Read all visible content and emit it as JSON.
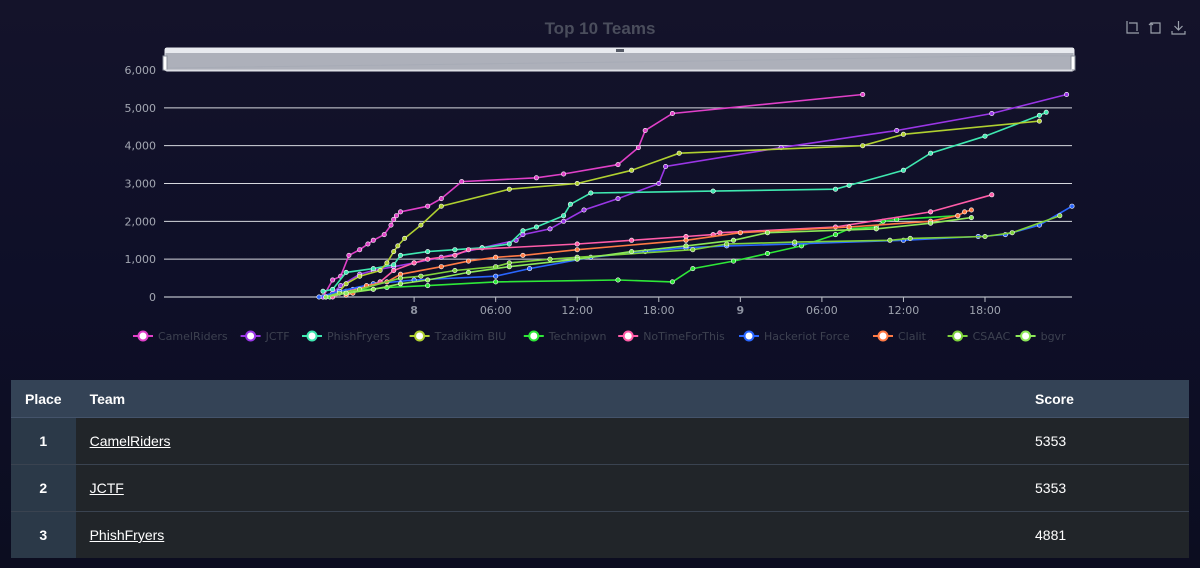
{
  "toolbox": {
    "icons": [
      "zoom-icon",
      "zoom-reset-icon",
      "download-icon"
    ]
  },
  "chart_data": {
    "type": "line",
    "title": "Top 10 Teams",
    "xlabel": "",
    "ylabel": "",
    "x_unit": "hours since day 7 00:00",
    "x_range": [
      5.6,
      72.4
    ],
    "ylim": [
      0,
      6000
    ],
    "y_ticks": [
      0,
      1000,
      2000,
      3000,
      4000,
      5000,
      6000
    ],
    "y_tick_labels": [
      "0",
      "1,000",
      "2,000",
      "3,000",
      "4,000",
      "5,000",
      "6,000"
    ],
    "x_ticks": [
      {
        "x": 24,
        "label": "8",
        "major": true
      },
      {
        "x": 30,
        "label": "06:00",
        "major": false
      },
      {
        "x": 36,
        "label": "12:00",
        "major": false
      },
      {
        "x": 42,
        "label": "18:00",
        "major": false
      },
      {
        "x": 48,
        "label": "9",
        "major": true
      },
      {
        "x": 54,
        "label": "06:00",
        "major": false
      },
      {
        "x": 60,
        "label": "12:00",
        "major": false
      },
      {
        "x": 66,
        "label": "18:00",
        "major": false
      }
    ],
    "grid": true,
    "legend_position": "bottom",
    "series": [
      {
        "name": "CamelRiders",
        "color": "#e040c8",
        "points": [
          [
            17.3,
            0
          ],
          [
            18.0,
            450
          ],
          [
            18.6,
            550
          ],
          [
            19.2,
            1100
          ],
          [
            20.0,
            1250
          ],
          [
            20.6,
            1400
          ],
          [
            21.0,
            1500
          ],
          [
            21.8,
            1650
          ],
          [
            22.3,
            1900
          ],
          [
            22.5,
            2050
          ],
          [
            22.7,
            2150
          ],
          [
            23.0,
            2250
          ],
          [
            25.0,
            2400
          ],
          [
            26.0,
            2600
          ],
          [
            27.5,
            3050
          ],
          [
            33.0,
            3150
          ],
          [
            35.0,
            3250
          ],
          [
            39.0,
            3500
          ],
          [
            40.5,
            3950
          ],
          [
            41.0,
            4400
          ],
          [
            43.0,
            4850
          ],
          [
            57.0,
            5353
          ]
        ]
      },
      {
        "name": "JCTF",
        "color": "#9a36e6",
        "points": [
          [
            17.3,
            0
          ],
          [
            18.0,
            100
          ],
          [
            18.6,
            300
          ],
          [
            20.0,
            600
          ],
          [
            21.0,
            700
          ],
          [
            22.5,
            800
          ],
          [
            24.0,
            900
          ],
          [
            26.0,
            1050
          ],
          [
            29.0,
            1300
          ],
          [
            31.5,
            1500
          ],
          [
            32.0,
            1650
          ],
          [
            34.0,
            1800
          ],
          [
            35.0,
            2000
          ],
          [
            36.5,
            2300
          ],
          [
            39.0,
            2600
          ],
          [
            42.0,
            3000
          ],
          [
            42.5,
            3450
          ],
          [
            51.0,
            3950
          ],
          [
            59.5,
            4400
          ],
          [
            66.5,
            4850
          ],
          [
            72.0,
            5353
          ]
        ]
      },
      {
        "name": "PhishFryers",
        "color": "#3fe8b0",
        "points": [
          [
            17.3,
            150
          ],
          [
            18.0,
            200
          ],
          [
            19.0,
            650
          ],
          [
            21.0,
            750
          ],
          [
            22.5,
            850
          ],
          [
            23.0,
            1100
          ],
          [
            25.0,
            1200
          ],
          [
            27.0,
            1250
          ],
          [
            29.0,
            1300
          ],
          [
            31.0,
            1400
          ],
          [
            32.0,
            1750
          ],
          [
            33.0,
            1850
          ],
          [
            35.0,
            2150
          ],
          [
            35.5,
            2450
          ],
          [
            37.0,
            2750
          ],
          [
            46.0,
            2800
          ],
          [
            55.0,
            2850
          ],
          [
            56.0,
            2950
          ],
          [
            60.0,
            3350
          ],
          [
            62.0,
            3800
          ],
          [
            66.0,
            4250
          ],
          [
            70.0,
            4800
          ],
          [
            70.5,
            4881
          ]
        ]
      },
      {
        "name": "Tzadikim BIU",
        "color": "#b0d030",
        "points": [
          [
            17.5,
            0
          ],
          [
            18.5,
            150
          ],
          [
            19.0,
            350
          ],
          [
            20.0,
            550
          ],
          [
            21.5,
            700
          ],
          [
            22.0,
            900
          ],
          [
            22.5,
            1200
          ],
          [
            22.8,
            1350
          ],
          [
            23.3,
            1550
          ],
          [
            24.5,
            1900
          ],
          [
            26.0,
            2400
          ],
          [
            31.0,
            2850
          ],
          [
            36.0,
            3000
          ],
          [
            40.0,
            3350
          ],
          [
            43.5,
            3800
          ],
          [
            57.0,
            4000
          ],
          [
            60.0,
            4300
          ],
          [
            70.0,
            4650
          ]
        ]
      },
      {
        "name": "Technipwn",
        "color": "#2ee838",
        "points": [
          [
            17.8,
            0
          ],
          [
            19.0,
            150
          ],
          [
            22.0,
            250
          ],
          [
            25.0,
            300
          ],
          [
            30.0,
            400
          ],
          [
            39.0,
            450
          ],
          [
            43.0,
            400
          ],
          [
            44.5,
            750
          ],
          [
            47.5,
            950
          ],
          [
            50.0,
            1150
          ],
          [
            52.5,
            1350
          ],
          [
            55.0,
            1650
          ],
          [
            56.0,
            1800
          ],
          [
            58.0,
            1850
          ],
          [
            58.5,
            2000
          ],
          [
            59.5,
            2050
          ],
          [
            64.0,
            2150
          ]
        ]
      },
      {
        "name": "NoTimeForThis",
        "color": "#ff5ca8",
        "points": [
          [
            18.0,
            0
          ],
          [
            19.5,
            200
          ],
          [
            21.5,
            400
          ],
          [
            22.5,
            700
          ],
          [
            24.0,
            900
          ],
          [
            25.0,
            1000
          ],
          [
            27.0,
            1100
          ],
          [
            28.0,
            1250
          ],
          [
            36.0,
            1400
          ],
          [
            40.0,
            1500
          ],
          [
            44.0,
            1600
          ],
          [
            46.0,
            1650
          ],
          [
            46.5,
            1700
          ],
          [
            55.0,
            1850
          ],
          [
            62.0,
            2250
          ],
          [
            66.5,
            2700
          ]
        ]
      },
      {
        "name": "Hackeriot Force",
        "color": "#2a66ff",
        "points": [
          [
            17.0,
            0
          ],
          [
            18.5,
            150
          ],
          [
            21.0,
            350
          ],
          [
            24.0,
            450
          ],
          [
            30.0,
            550
          ],
          [
            32.5,
            750
          ],
          [
            37.0,
            1050
          ],
          [
            41.0,
            1200
          ],
          [
            44.0,
            1300
          ],
          [
            47.0,
            1350
          ],
          [
            52.0,
            1400
          ],
          [
            60.0,
            1500
          ],
          [
            65.5,
            1600
          ],
          [
            67.5,
            1650
          ],
          [
            70.0,
            1900
          ],
          [
            72.4,
            2400
          ]
        ]
      },
      {
        "name": "Clalit",
        "color": "#ff7a45",
        "points": [
          [
            19.0,
            50
          ],
          [
            19.5,
            100
          ],
          [
            20.5,
            300
          ],
          [
            22.0,
            400
          ],
          [
            23.0,
            600
          ],
          [
            26.0,
            800
          ],
          [
            28.0,
            950
          ],
          [
            30.0,
            1050
          ],
          [
            32.0,
            1100
          ],
          [
            36.0,
            1250
          ],
          [
            44.0,
            1500
          ],
          [
            48.0,
            1700
          ],
          [
            56.0,
            1850
          ],
          [
            62.0,
            2000
          ],
          [
            64.0,
            2150
          ],
          [
            64.5,
            2250
          ],
          [
            65.0,
            2300
          ]
        ]
      },
      {
        "name": "CSAAC",
        "color": "#7ed23c",
        "points": [
          [
            17.5,
            0
          ],
          [
            18.5,
            100
          ],
          [
            20.0,
            200
          ],
          [
            23.0,
            500
          ],
          [
            24.5,
            550
          ],
          [
            27.0,
            700
          ],
          [
            30.0,
            800
          ],
          [
            31.0,
            900
          ],
          [
            34.0,
            1000
          ],
          [
            36.0,
            1050
          ],
          [
            44.5,
            1250
          ],
          [
            47.0,
            1400
          ],
          [
            52.0,
            1450
          ],
          [
            59.0,
            1500
          ],
          [
            60.5,
            1550
          ],
          [
            66.0,
            1600
          ],
          [
            68.0,
            1700
          ],
          [
            71.5,
            2150
          ]
        ]
      },
      {
        "name": "bgvr",
        "color": "#8ce858",
        "points": [
          [
            17.5,
            0
          ],
          [
            19.0,
            100
          ],
          [
            21.0,
            200
          ],
          [
            23.0,
            350
          ],
          [
            25.0,
            450
          ],
          [
            28.0,
            650
          ],
          [
            31.0,
            800
          ],
          [
            36.0,
            1000
          ],
          [
            40.0,
            1200
          ],
          [
            44.0,
            1350
          ],
          [
            47.5,
            1500
          ],
          [
            50.0,
            1700
          ],
          [
            58.0,
            1800
          ],
          [
            62.0,
            1950
          ],
          [
            65.0,
            2100
          ]
        ]
      }
    ]
  },
  "leaderboard": {
    "headers": {
      "place": "Place",
      "team": "Team",
      "score": "Score"
    },
    "rows": [
      {
        "place": "1",
        "team": "CamelRiders",
        "score": "5353"
      },
      {
        "place": "2",
        "team": "JCTF",
        "score": "5353"
      },
      {
        "place": "3",
        "team": "PhishFryers",
        "score": "4881"
      }
    ]
  }
}
